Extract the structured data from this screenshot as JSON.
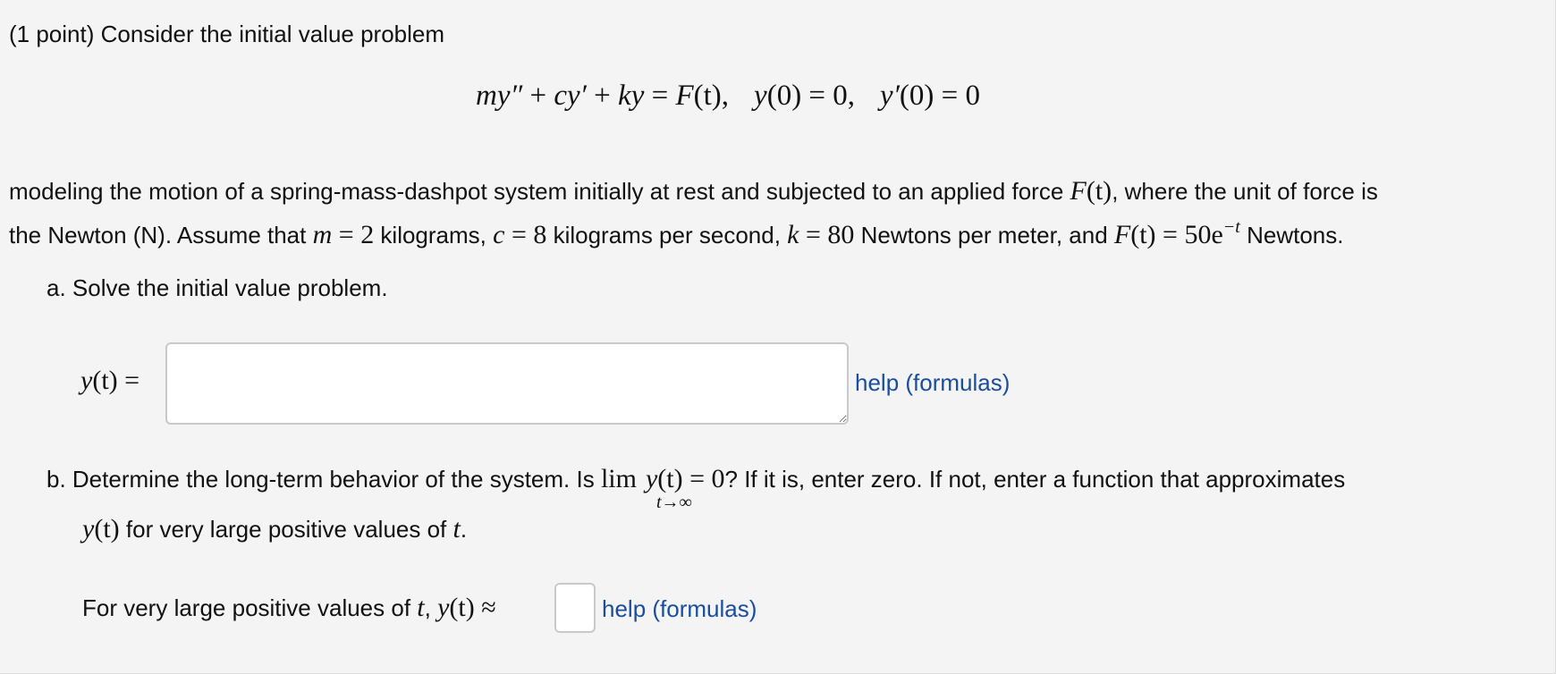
{
  "problem": {
    "intro": "(1 point) Consider the initial value problem",
    "equation": {
      "lhs_m": "m",
      "lhs_y2": "y″",
      "plus1": " + ",
      "lhs_c": "c",
      "lhs_y1": "y′",
      "plus2": " + ",
      "lhs_k": "k",
      "lhs_y": "y",
      "eq1": " = ",
      "F": "F",
      "F_arg": "(t),",
      "ic1_y": "y",
      "ic1_rest": "(0) = 0,",
      "ic2_y": "y′",
      "ic2_rest": "(0) = 0"
    },
    "line1_text": "modeling the motion of a spring-mass-dashpot system initially at rest and subjected to an applied force ",
    "line1_F": "F",
    "line1_F_arg": "(t)",
    "line1_rest": ", where the unit of force is",
    "line2_a": "the Newton (N). Assume that ",
    "m_sym": "m",
    "eq_sign": " = ",
    "m_val": "2",
    "m_unit": " kilograms, ",
    "c_sym": "c",
    "c_val": "8",
    "c_unit": " kilograms per second, ",
    "k_sym": "k",
    "k_val": "80",
    "k_unit": " Newtons per meter, and ",
    "F_sym": "F",
    "F_arg": "(t)",
    "F_val": "50e",
    "F_exp": "−t",
    "F_unit": " Newtons."
  },
  "part_a": {
    "label": "a. Solve the initial value problem.",
    "answer_label_y": "y",
    "answer_label_rest": "(t) =",
    "answer_value": "",
    "help_link": "help (formulas)"
  },
  "part_b": {
    "label_start": "b. Determine the long-term behavior of the system. Is ",
    "lim": "lim",
    "lim_sub": "t→∞",
    "lim_y": "y",
    "lim_arg": "(t) = 0",
    "label_end": "? If it is, enter zero. If not, enter a function that approximates",
    "line2_y": "y",
    "line2_arg": "(t)",
    "line2_text": " for very large positive values of ",
    "line2_t": "t",
    "line2_dot": ".",
    "answer_prefix": "For very large positive values of ",
    "answer_t": "t",
    "answer_comma": ", ",
    "answer_y": "y",
    "answer_arg": "(t) ≈",
    "answer_value": "",
    "help_link": "help (formulas)"
  }
}
